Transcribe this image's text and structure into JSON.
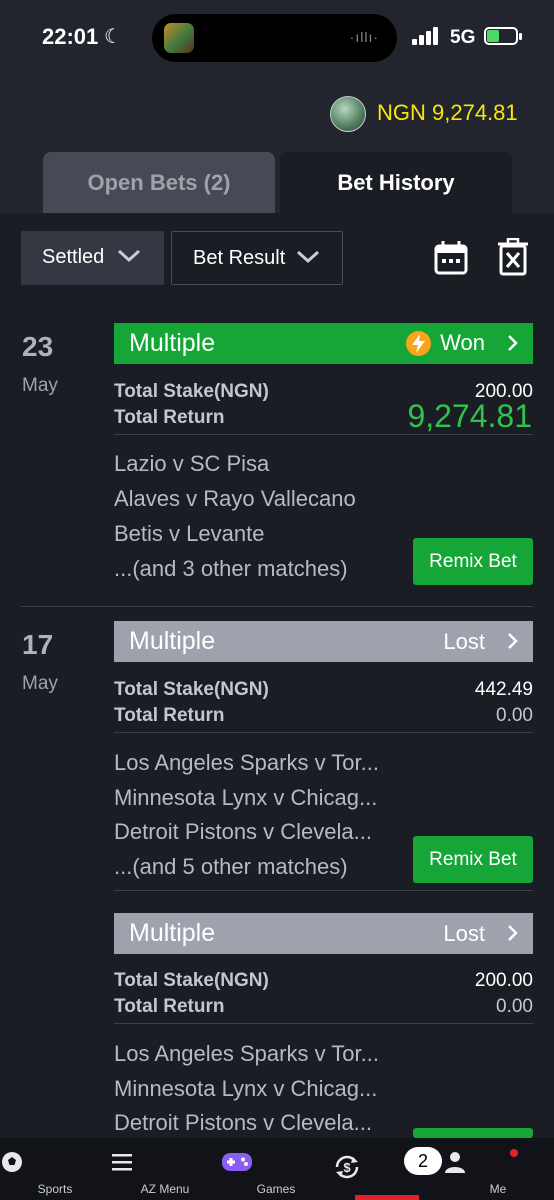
{
  "status": {
    "time": "22:01",
    "network": "5G"
  },
  "header": {
    "balance": "NGN 9,274.81"
  },
  "tabs": [
    {
      "label": "Open Bets (2)",
      "active": false
    },
    {
      "label": "Bet History",
      "active": true
    }
  ],
  "filters": {
    "status": "Settled",
    "result": "Bet Result"
  },
  "bets": [
    {
      "day": "23",
      "month": "May",
      "type": "Multiple",
      "status": "Won",
      "stake_label": "Total Stake(NGN)",
      "stake": "200.00",
      "return_label": "Total Return",
      "return": "9,274.81",
      "matches": [
        "Lazio v SC Pisa",
        "Alaves v Rayo Vallecano",
        "Betis v Levante",
        "...(and 3 other matches)"
      ],
      "remix_label": "Remix Bet"
    },
    {
      "day": "17",
      "month": "May",
      "type": "Multiple",
      "status": "Lost",
      "stake_label": "Total Stake(NGN)",
      "stake": "442.49",
      "return_label": "Total Return",
      "return": "0.00",
      "matches": [
        "Los Angeles Sparks v Tor...",
        "Minnesota Lynx v Chicag...",
        "Detroit Pistons v Clevela...",
        "...(and 5 other matches)"
      ],
      "remix_label": "Remix Bet"
    },
    {
      "type": "Multiple",
      "status": "Lost",
      "stake_label": "Total Stake(NGN)",
      "stake": "200.00",
      "return_label": "Total Return",
      "return": "0.00",
      "matches": [
        "Los Angeles Sparks v Tor...",
        "Minnesota Lynx v Chicag...",
        "Detroit Pistons v Clevela..."
      ]
    }
  ],
  "nav": [
    {
      "label": "Sports",
      "icon": "soccer-ball-icon"
    },
    {
      "label": "AZ Menu",
      "icon": "menu-icon"
    },
    {
      "label": "Games",
      "icon": "gamepad-icon"
    },
    {
      "label": "",
      "icon": "cashout-icon",
      "badge": "2",
      "active": true
    },
    {
      "label": "Me",
      "icon": "user-icon"
    }
  ],
  "colors": {
    "accent_green": "#16a637",
    "balance_yellow": "#f7e60a",
    "active_red": "#e4202c",
    "lost_grey": "#9ea2ad"
  }
}
